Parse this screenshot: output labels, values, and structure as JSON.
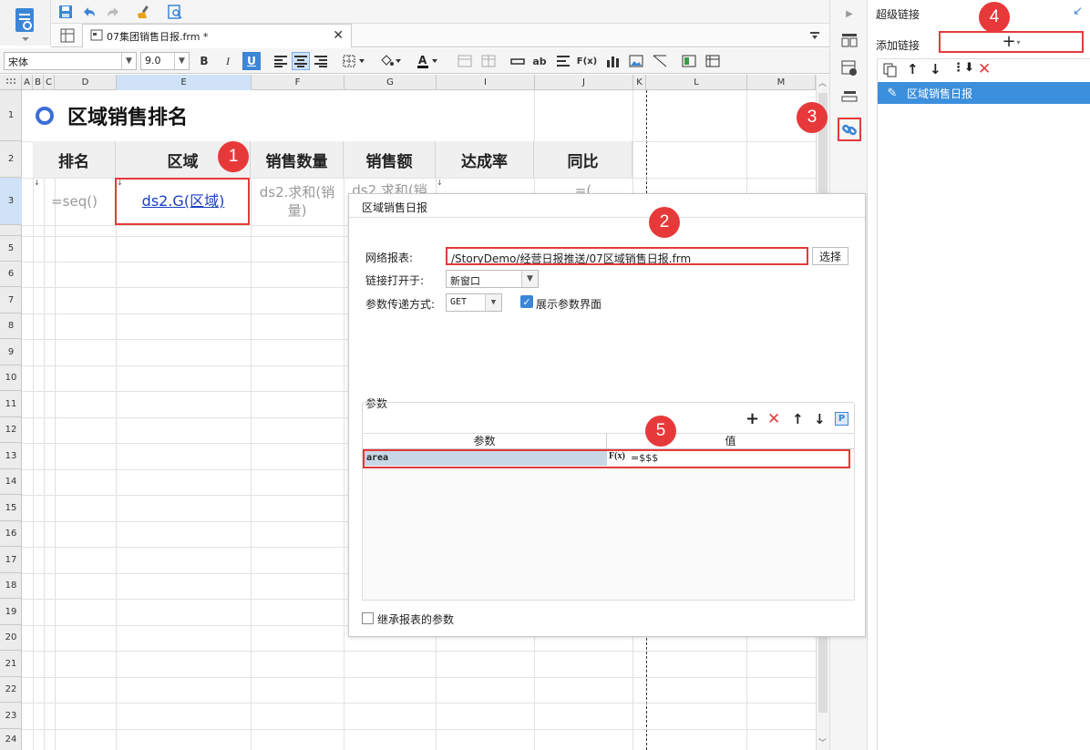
{
  "app": {
    "file_tab": "07集团销售日报.frm *"
  },
  "toolbar": {
    "font_name": "宋体",
    "font_size": "9.0",
    "bold": "B",
    "italic": "I",
    "underline": "U",
    "text_label": "ab",
    "formula_label": "F(x)"
  },
  "columns": [
    "A",
    "B",
    "C",
    "D",
    "E",
    "F",
    "G",
    "I",
    "J",
    "K",
    "L",
    "M"
  ],
  "rows": [
    "1",
    "2",
    "3",
    "5",
    "6",
    "7",
    "8",
    "9",
    "10",
    "11",
    "12",
    "13",
    "14",
    "15",
    "16",
    "17",
    "18",
    "19",
    "20",
    "21",
    "22",
    "23",
    "24"
  ],
  "sheet": {
    "title": "区域销售排名",
    "headers": [
      "排名",
      "区域",
      "销售数量",
      "销售额",
      "达成率",
      "同比"
    ],
    "row3": {
      "rank": "=seq()",
      "area": "ds2.G(区域)",
      "qty": "ds2.求和(销量)",
      "amount": "ds2.求和(销",
      "yoy": "=("
    }
  },
  "badges": [
    "1",
    "2",
    "3",
    "4",
    "5"
  ],
  "right_panel": {
    "title": "超级链接",
    "add_link_label": "添加链接",
    "add_icon": "plus-icon",
    "list_items": [
      {
        "label": "区域销售日报",
        "selected": true
      }
    ]
  },
  "dialog": {
    "title": "区域销售日报",
    "report_label": "网络报表:",
    "report_path": "/StoryDemo/经营日报推送/07区域销售日报.frm",
    "select_button": "选择",
    "open_in_label": "链接打开于:",
    "open_in_value": "新窗口",
    "method_label": "参数传递方式:",
    "method_value": "GET",
    "show_param_label": "展示参数界面",
    "show_param_checked": true,
    "params_group_label": "参数",
    "param_col_name": "参数",
    "param_col_value": "值",
    "params": [
      {
        "name": "area",
        "value": "=$$$"
      }
    ],
    "inherit_label": "继承报表的参数",
    "inherit_checked": false
  },
  "colors": {
    "accent": "#3b86d6",
    "highlight": "#e53a3a",
    "selected_row": "#3c8fdc",
    "link": "#1a3fc4"
  }
}
